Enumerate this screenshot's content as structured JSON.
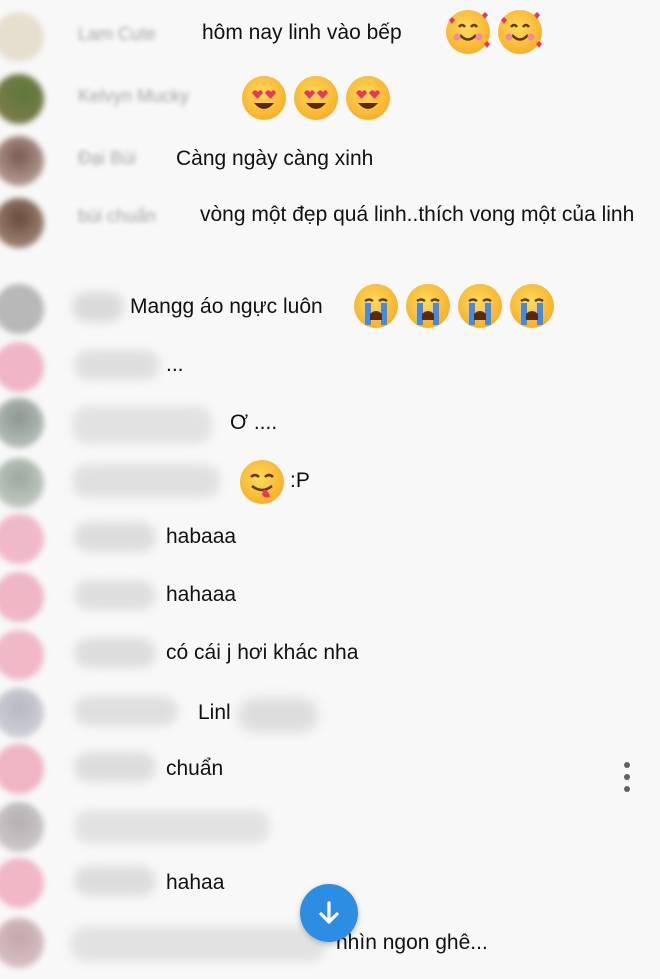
{
  "messages": [
    {
      "author": "Lam Cute",
      "text": "hôm nay linh vào bếp",
      "emojis": [
        "smiling-face-with-hearts-icon",
        "smiling-face-with-hearts-icon"
      ]
    },
    {
      "author": "Kelvyn Mucky",
      "text": "",
      "emojis": [
        "heart-eyes-icon",
        "heart-eyes-icon",
        "heart-eyes-icon"
      ]
    },
    {
      "author": "Đại Bùi",
      "text": "Càng ngày càng xinh",
      "emojis": []
    },
    {
      "author": "bùi chuẩn",
      "text": "vòng một đẹp quá linh..thích vong một của linh",
      "emojis": []
    },
    {
      "author": "",
      "text": "Mangg áo ngực luôn",
      "emojis": [
        "loudly-crying-icon",
        "loudly-crying-icon",
        "loudly-crying-icon",
        "loudly-crying-icon"
      ]
    },
    {
      "author": "",
      "text": "...",
      "emojis": []
    },
    {
      "author": "",
      "text": "Ơ ....",
      "emojis": []
    },
    {
      "author": "",
      "text": ":P",
      "emojis": [
        "yum-face-icon"
      ]
    },
    {
      "author": "",
      "text": "habaaa",
      "emojis": []
    },
    {
      "author": "",
      "text": "hahaaa",
      "emojis": []
    },
    {
      "author": "",
      "text": "có cái j hơi khác nha",
      "emojis": []
    },
    {
      "author": "",
      "text": "Linl",
      "emojis": []
    },
    {
      "author": "",
      "text": "chuẩn",
      "emojis": []
    },
    {
      "author": "",
      "text": "",
      "emojis": []
    },
    {
      "author": "",
      "text": "hahaa",
      "emojis": []
    },
    {
      "author": "",
      "text": "nhìn ngon ghê...",
      "emojis": []
    }
  ],
  "controls": {
    "more_menu_icon": "more-vert-icon",
    "scroll_down_icon": "arrow-down-icon"
  },
  "colors": {
    "background": "#f8f8f8",
    "accent": "#2c8de3",
    "avatar_pink": "#f2b7c8",
    "avatar_gray": "#b9b9b9"
  }
}
